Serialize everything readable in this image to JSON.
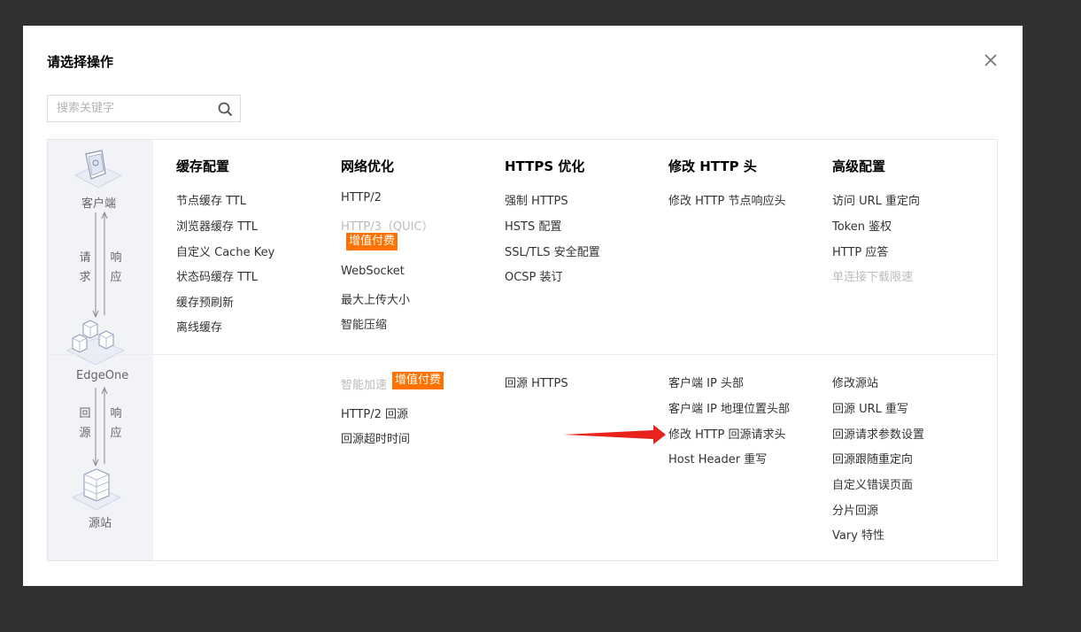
{
  "dialog": {
    "title": "请选择操作",
    "search_placeholder": "搜索关键字"
  },
  "diagram": {
    "client_label": "客户端",
    "request_chars": [
      "请",
      "求"
    ],
    "response_chars": [
      "响",
      "应"
    ],
    "edge_label": "EdgeOne",
    "origin_chars": [
      "回",
      "源"
    ],
    "origin_response_chars": [
      "响",
      "应"
    ],
    "origin_label": "源站"
  },
  "columns": [
    {
      "header": "缓存配置",
      "top": [
        "节点缓存 TTL",
        "浏览器缓存 TTL",
        "自定义 Cache Key",
        "状态码缓存 TTL",
        "缓存预刷新",
        "离线缓存"
      ],
      "bottom": []
    },
    {
      "header": "网络优化",
      "top": [
        "HTTP/2",
        "HTTP/3（QUIC）",
        "WebSocket",
        "最大上传大小",
        "智能压缩"
      ],
      "top_badge": "增值付费",
      "bottom": [
        "智能加速",
        "HTTP/2 回源",
        "回源超时时间"
      ],
      "bottom_badge": "增值付费"
    },
    {
      "header": "HTTPS 优化",
      "top": [
        "强制 HTTPS",
        "HSTS 配置",
        "SSL/TLS 安全配置",
        "OCSP 装订"
      ],
      "bottom": [
        "回源 HTTPS"
      ]
    },
    {
      "header": "修改 HTTP 头",
      "top": [
        "修改 HTTP 节点响应头"
      ],
      "bottom": [
        "客户端 IP 头部",
        "客户端 IP 地理位置头部",
        "修改 HTTP 回源请求头",
        "Host Header 重写"
      ]
    },
    {
      "header": "高级配置",
      "top": [
        "访问 URL 重定向",
        "Token 鉴权",
        "HTTP 应答",
        "单连接下载限速"
      ],
      "bottom": [
        "修改源站",
        "回源 URL 重写",
        "回源请求参数设置",
        "回源跟随重定向",
        "自定义错误页面",
        "分片回源",
        "Vary 特性"
      ]
    }
  ],
  "colors": {
    "badge": "#ff7200",
    "arrow": "#e8231b",
    "disabled_text": "#bbbbbb"
  }
}
